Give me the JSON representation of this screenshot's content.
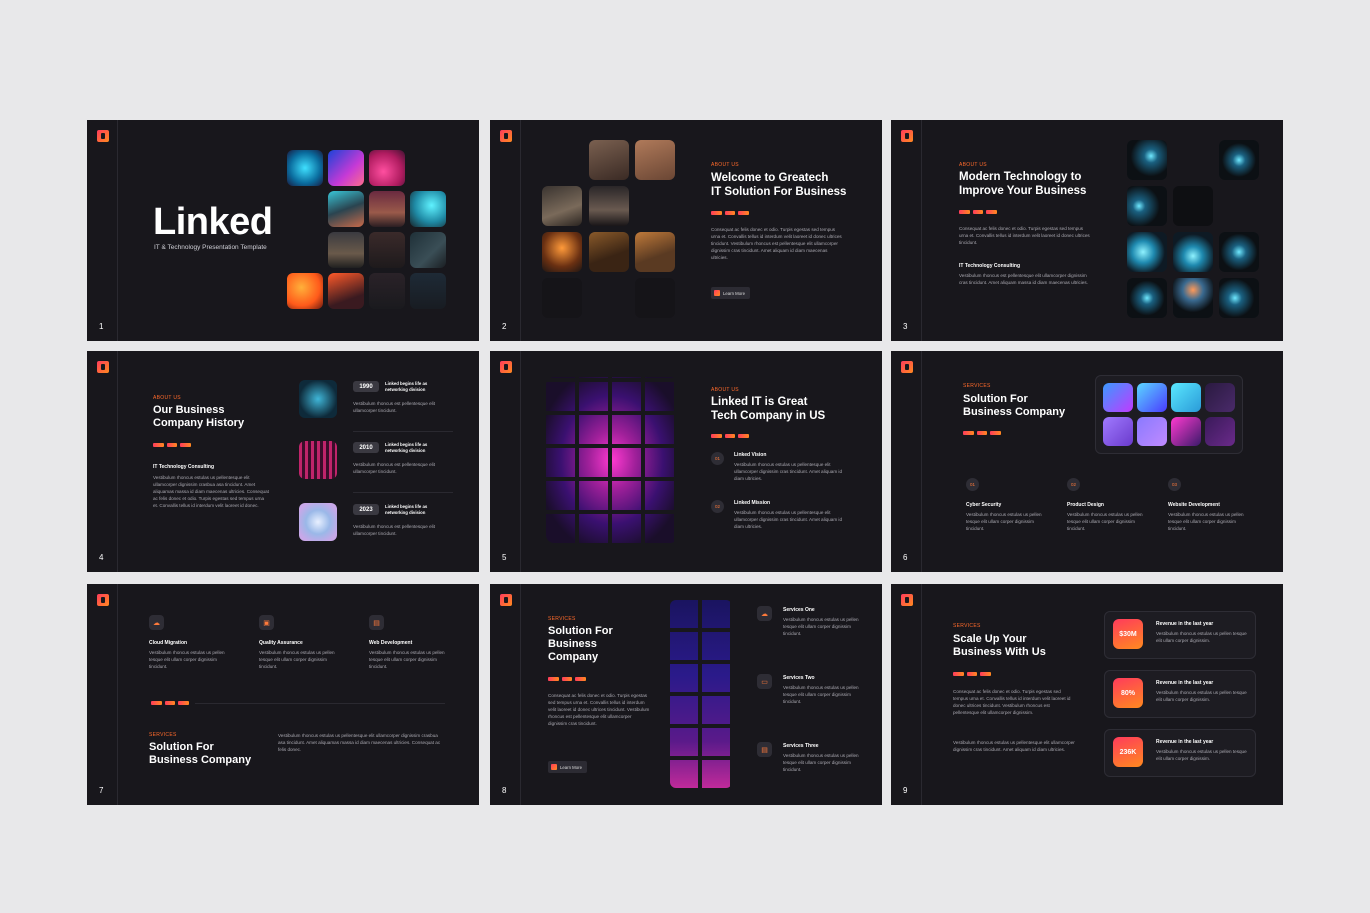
{
  "slides": [
    {
      "number": "1",
      "title": "Linked",
      "subtitle": "IT & Technology Presentation Template"
    },
    {
      "number": "2",
      "eyebrow": "ABOUT US",
      "title_l1": "Welcome to Greatech",
      "title_l2": "IT Solution For Business",
      "body": "Consequat ac felis donec et odio. Turpis egestas sed tempus urna et. Convallis tellus id interdum velit laoreet id donec ultrices tincidunt. Vestibulum rhoncus est pellentesque elit ullamcorper dignissim cras tincidunt. Amet aliquam id diam maecenas ultricies.",
      "button": "Learn More"
    },
    {
      "number": "3",
      "eyebrow": "ABOUT US",
      "title_l1": "Modern Technology to",
      "title_l2": "Improve Your Business",
      "body": "Consequat ac felis donec et odio. Turpis egestas sed tempus urna et. Convallis tellus id interdum velit laoreet id donec ultrices tincidunt.",
      "subheading": "IT Technology Consulting",
      "body2": "Vestibulum rhoncus est pellentesque elit ullamcorper dignissim cras tincidunt. Amet aliquam massa id diam maecenas ultricies."
    },
    {
      "number": "4",
      "eyebrow": "ABOUT US",
      "title_l1": "Our Business",
      "title_l2": "Company History",
      "subheading": "IT Technology Consulting",
      "body": "Vestibulum rhoncus estulas us pellentesque elit ullamcorper dignissim crasbua asa tincidunt. Amet aliquamas massa id diam maecenas ultricies. Consequat ac felis donec et odio. Turpis egestas sed tempus urna et. Convallis tellus id interdum velit laoreet id donec.",
      "timeline": [
        {
          "year": "1990",
          "title": "Linked begins life as networking division",
          "desc": "Vestibulum rhoncus est pellentesque elit ullamcorper tincidunt."
        },
        {
          "year": "2010",
          "title": "Linked begins life as networking division",
          "desc": "Vestibulum rhoncus est pellentesque elit ullamcorper tincidunt."
        },
        {
          "year": "2023",
          "title": "Linked begins life as networking division",
          "desc": "Vestibulum rhoncus est pellentesque elit ullamcorper tincidunt."
        }
      ]
    },
    {
      "number": "5",
      "eyebrow": "ABOUT US",
      "title_l1": "Linked IT is Great",
      "title_l2": "Tech Company in US",
      "items": [
        {
          "badge": "01",
          "title": "Linked Vision",
          "desc": "Vestibulum rhoncus estulas us pellentesque elit ullamcorper dignissim cras tincidunt. Amet aliquam id diam ultricies."
        },
        {
          "badge": "02",
          "title": "Linked Mission",
          "desc": "Vestibulum rhoncus estulas us pellentesque elit ullamcorper dignissim cras tincidunt. Amet aliquam id diam ultricies."
        }
      ]
    },
    {
      "number": "6",
      "eyebrow": "SERVICES",
      "title_l1": "Solution For",
      "title_l2": "Business Company",
      "items": [
        {
          "badge": "01",
          "title": "Cyber Security",
          "desc": "Vestibulum rhoncus estulas us pellen tesque elit ullam corper dignissim tincidunt."
        },
        {
          "badge": "02",
          "title": "Product Design",
          "desc": "Vestibulum rhoncus estulas us pellen tesque elit ullam corper dignissim tincidunt."
        },
        {
          "badge": "03",
          "title": "Website Development",
          "desc": "Vestibulum rhoncus estulas us pellen tesque elit ullam corper dignissim tincidunt."
        }
      ]
    },
    {
      "number": "7",
      "eyebrow": "SERVICES",
      "title_l1": "Solution For",
      "title_l2": "Business Company",
      "body": "Vestibulum rhoncus estulas us pellentesque elit ullamcorper dignissim crasbua asa tincidunt. Amet aliquamas massa id diam maecenas ultricies. Consequat ac felis donec.",
      "items": [
        {
          "title": "Cloud Migration",
          "desc": "Vestibulum rhoncus estulas us pellen tesque elit ullam corper dignissim tincidunt."
        },
        {
          "title": "Quality Assurance",
          "desc": "Vestibulum rhoncus estulas us pellen tesque elit ullam corper dignissim tincidunt."
        },
        {
          "title": "Web Development",
          "desc": "Vestibulum rhoncus estulas us pellen tesque elit ullam corper dignissim tincidunt."
        }
      ]
    },
    {
      "number": "8",
      "eyebrow": "SERVICES",
      "title_l1": "Solution For",
      "title_l2": "Business",
      "title_l3": "Company",
      "body": "Consequat ac felis donec et odio. Turpis egestas sed tempus urna et. Convallis tellus id interdum velit laoreet id donec ultrices tincidunt. Vestibulum rhoncus est pellentesque elit ullamcorper dignissim cras tincidunt.",
      "button": "Learn More",
      "items": [
        {
          "title": "Services One",
          "desc": "Vestibulum rhoncus estulas us pellen tesque elit ullam corper dignissim tincidunt."
        },
        {
          "title": "Services Two",
          "desc": "Vestibulum rhoncus estulas us pellen tesque elit ullam corper dignissim tincidunt."
        },
        {
          "title": "Services Three",
          "desc": "Vestibulum rhoncus estulas us pellen tesque elit ullam corper dignissim tincidunt."
        }
      ]
    },
    {
      "number": "9",
      "eyebrow": "SERVICES",
      "title_l1": "Scale Up Your",
      "title_l2": "Business With Us",
      "body": "Consequat ac felis donec et odio. Turpis egestas sed tempus urna et. Convallis tellus id interdum velit laoreet id donec ultrices tincidunt. Vestibulum rhoncus est pellentesque elit ullamcorper dignissim.",
      "body2": "Vestibulum rhoncus estulas us pellentesque elit ullamcorper dignissim cras tincidunt. Amet aliquam id diam ultricies.",
      "stats": [
        {
          "value": "$30M",
          "title": "Revenue in the last year",
          "desc": "Vestibulum rhoncus estulas us pellen tesque elit ullam corper dignissim."
        },
        {
          "value": "80%",
          "title": "Revenue in the last year",
          "desc": "Vestibulum rhoncus estulas us pellen tesque elit ullam corper dignissim."
        },
        {
          "value": "236K",
          "title": "Revenue in the last year",
          "desc": "Vestibulum rhoncus estulas us pellen tesque elit ullam corper dignissim."
        }
      ]
    }
  ],
  "colors": {
    "background": "#e8e8ea",
    "slide": "#18171c",
    "accent_start": "#ff3b5c",
    "accent_end": "#ff8a1f"
  }
}
